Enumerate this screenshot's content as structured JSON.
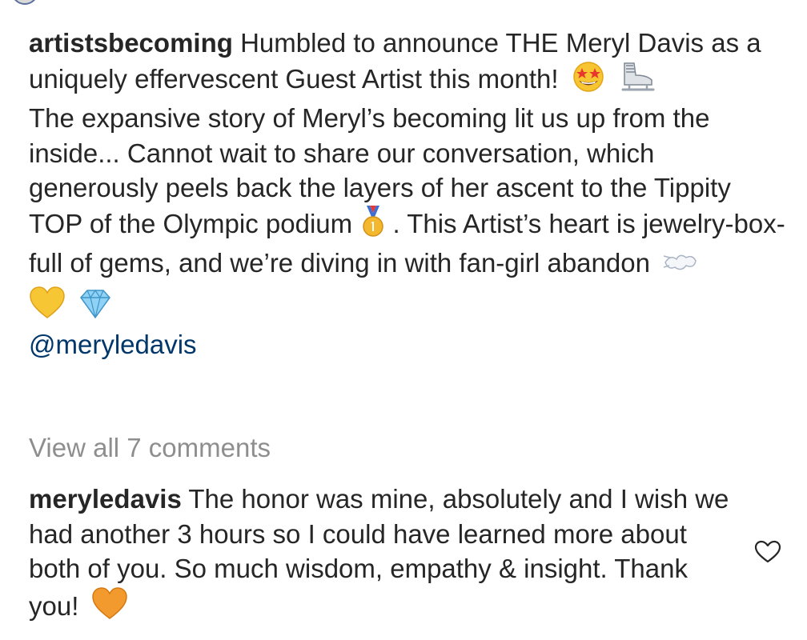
{
  "caption": {
    "username": "artistsbecoming",
    "line1": "Humbled to announce THE Meryl Davis as a uniquely effervescent Guest Artist this month!",
    "line2a": "The expansive story of Meryl’s becoming lit us up from the inside... Cannot wait to share our conversation, which generously peels back the layers of her ascent to the Tippity TOP of the Olympic podium",
    "line2b": ". This Artist’s heart is jewelry-box-full of gems, and we’re diving in with fan-girl abandon",
    "mention": "@meryledavis",
    "emojis": [
      "star-struck-face-emoji",
      "ice-skate-emoji",
      "gold-medal-emoji",
      "dash-emoji",
      "yellow-heart-emoji",
      "gem-stone-emoji"
    ]
  },
  "view_comments_label": "View all 7 comments",
  "comment": {
    "username": "meryledavis",
    "text": "The honor was mine, absolutely and I wish we had another 3 hours so I could have learned more about both of you. So much wisdom, empathy & insight. Thank you!",
    "emoji": "orange-heart-emoji",
    "like_icon": "heart-outline-icon"
  },
  "colors": {
    "text": "#262626",
    "muted": "#8e8e8e",
    "mention": "#00376b",
    "background": "#ffffff"
  }
}
